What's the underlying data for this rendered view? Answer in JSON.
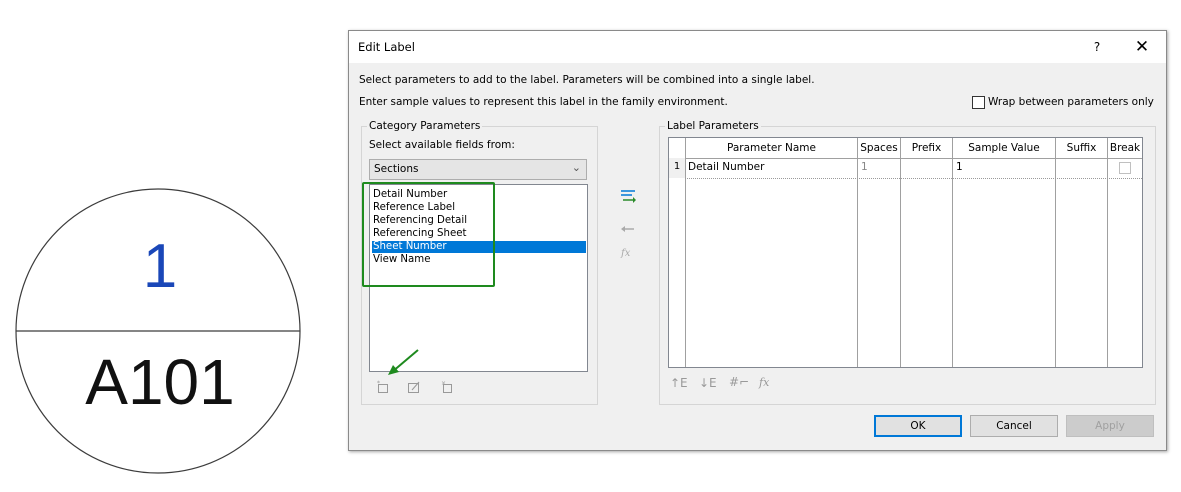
{
  "tag": {
    "top_value": "1",
    "bottom_value": "A101",
    "top_color": "#1a47b8"
  },
  "dialog": {
    "title": "Edit Label",
    "help": "?",
    "close": "✕",
    "instruction1": "Select parameters to add to the label.  Parameters will be combined into a single label.",
    "instruction2": "Enter sample values to represent this label in the family environment.",
    "wrap_label": "Wrap between parameters only",
    "wrap_checked": false
  },
  "category": {
    "legend": "Category Parameters",
    "select_label": "Select available fields from:",
    "select_value": "Sections",
    "fields": [
      {
        "label": "Detail Number",
        "selected": false
      },
      {
        "label": "Reference Label",
        "selected": false
      },
      {
        "label": "Referencing Detail",
        "selected": false
      },
      {
        "label": "Referencing Sheet",
        "selected": false
      },
      {
        "label": "Sheet Number",
        "selected": true
      },
      {
        "label": "View Name",
        "selected": false
      }
    ],
    "highlight_color": "#1e8a1e"
  },
  "label_params": {
    "legend": "Label Parameters",
    "columns": [
      "Parameter Name",
      "Spaces",
      "Prefix",
      "Sample Value",
      "Suffix",
      "Break"
    ],
    "rows": [
      {
        "index": "1",
        "name": "Detail Number",
        "spaces": "1",
        "prefix": "",
        "sample": "1",
        "suffix": "",
        "break": false
      }
    ]
  },
  "buttons": {
    "ok": "OK",
    "cancel": "Cancel",
    "apply": "Apply"
  },
  "icons": {
    "add": "add-parameter-icon",
    "remove": "remove-parameter-icon",
    "formula": "fx-icon",
    "new_param": "new-parameter-icon",
    "edit_param": "edit-parameter-icon",
    "delete_param": "delete-parameter-icon",
    "move_up": "move-up-icon",
    "move_down": "move-down-icon",
    "format": "number-format-icon",
    "fx_sample": "formula-sample-icon",
    "accent": "#0078d7"
  }
}
